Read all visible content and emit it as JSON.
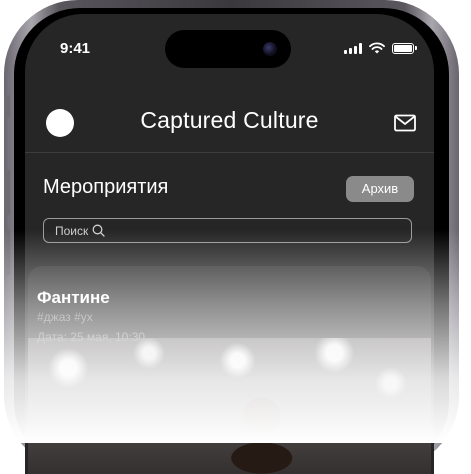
{
  "status_bar": {
    "time": "9:41"
  },
  "header": {
    "title": "Captured Culture"
  },
  "events_page": {
    "title": "Мероприятия",
    "archive_label": "Архив",
    "search_placeholder": "Поиск"
  },
  "events": [
    {
      "title": "Фантине",
      "tags": "#джаз #ух",
      "date": "Дата: 25 мая, 10:30"
    }
  ],
  "icons": {
    "mail": "mail-icon",
    "search": "search-icon",
    "wifi": "wifi-icon",
    "battery": "battery-icon",
    "signal": "signal-icon"
  }
}
